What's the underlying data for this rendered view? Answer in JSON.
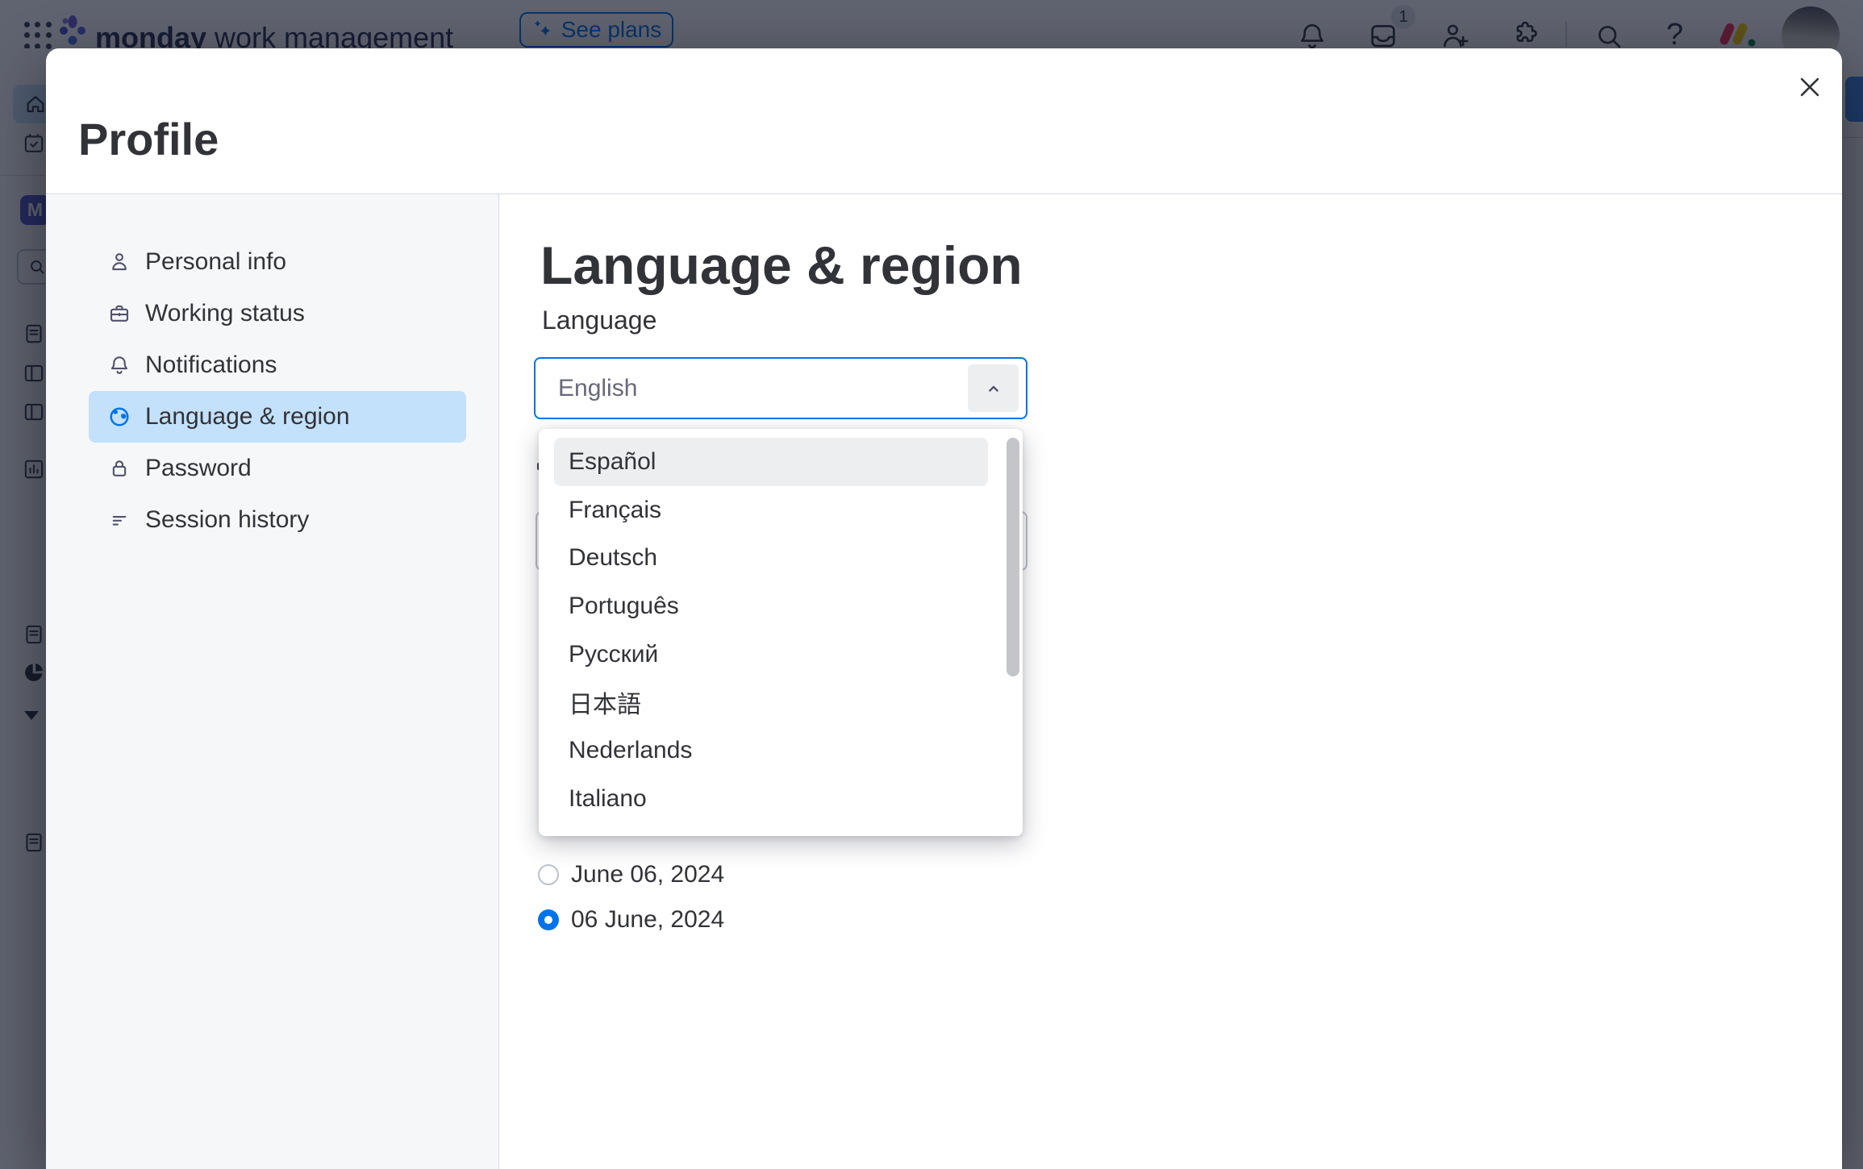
{
  "topbar": {
    "product_name_bold": "monday",
    "product_name_rest": " work management",
    "see_plans_label": "See plans",
    "inbox_badge_count": "1",
    "help_glyph": "?"
  },
  "left_rail": {
    "workspace_initial": "M"
  },
  "modal": {
    "title": "Profile",
    "nav_items": [
      {
        "label": "Personal info",
        "icon": "person-icon",
        "selected": false
      },
      {
        "label": "Working status",
        "icon": "briefcase-icon",
        "selected": false
      },
      {
        "label": "Notifications",
        "icon": "bell-icon",
        "selected": false
      },
      {
        "label": "Language & region",
        "icon": "globe-icon",
        "selected": true
      },
      {
        "label": "Password",
        "icon": "lock-icon",
        "selected": false
      },
      {
        "label": "Session history",
        "icon": "history-icon",
        "selected": false
      }
    ],
    "content": {
      "heading": "Language & region",
      "language_label": "Language",
      "language_select_value": "English",
      "language_options": [
        "Español",
        "Français",
        "Deutsch",
        "Português",
        "Русский",
        "日本語",
        "Nederlands",
        "Italiano"
      ],
      "highlighted_option": "Español",
      "date_format_options": [
        {
          "label": "June 06, 2024",
          "selected": false
        },
        {
          "label": "06 June, 2024",
          "selected": true
        }
      ]
    }
  },
  "colors": {
    "accent_blue": "#0073ea",
    "selected_nav_bg": "#c3e1fb",
    "text_primary": "#323338",
    "text_secondary": "#676879",
    "sidebar_bg": "#f6f7f9",
    "option_highlight_bg": "#eceef0"
  }
}
